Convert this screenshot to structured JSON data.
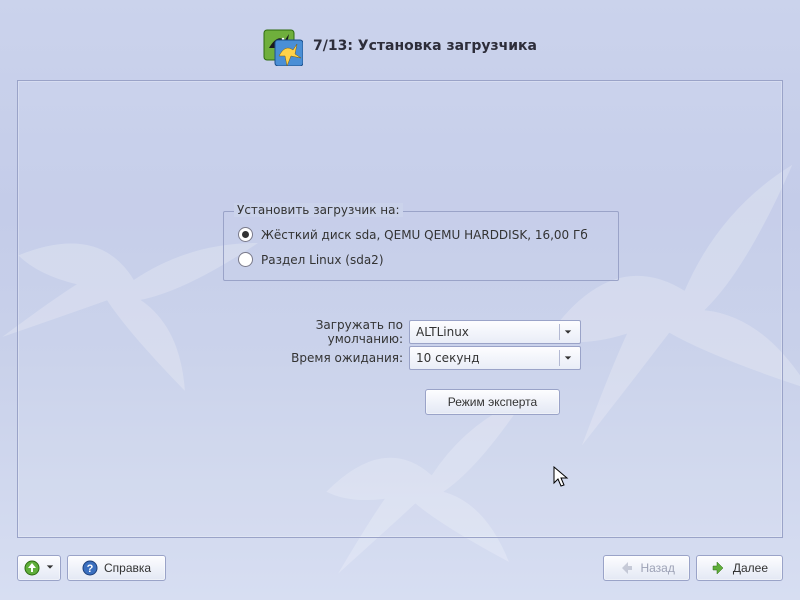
{
  "header": {
    "title": "7/13: Установка загрузчика"
  },
  "install_target": {
    "legend": "Установить загрузчик на:",
    "options": [
      {
        "label": "Жёсткий диск sda, QEMU QEMU HARDDISK, 16,00 Гб",
        "selected": true
      },
      {
        "label": "Раздел Linux (sda2)",
        "selected": false
      }
    ]
  },
  "default_boot": {
    "label": "Загружать по умолчанию:",
    "value": "ALTLinux"
  },
  "timeout": {
    "label": "Время ожидания:",
    "value": "10 секунд"
  },
  "buttons": {
    "expert": "Режим эксперта",
    "help": "Справка",
    "back": "Назад",
    "next": "Далее"
  }
}
